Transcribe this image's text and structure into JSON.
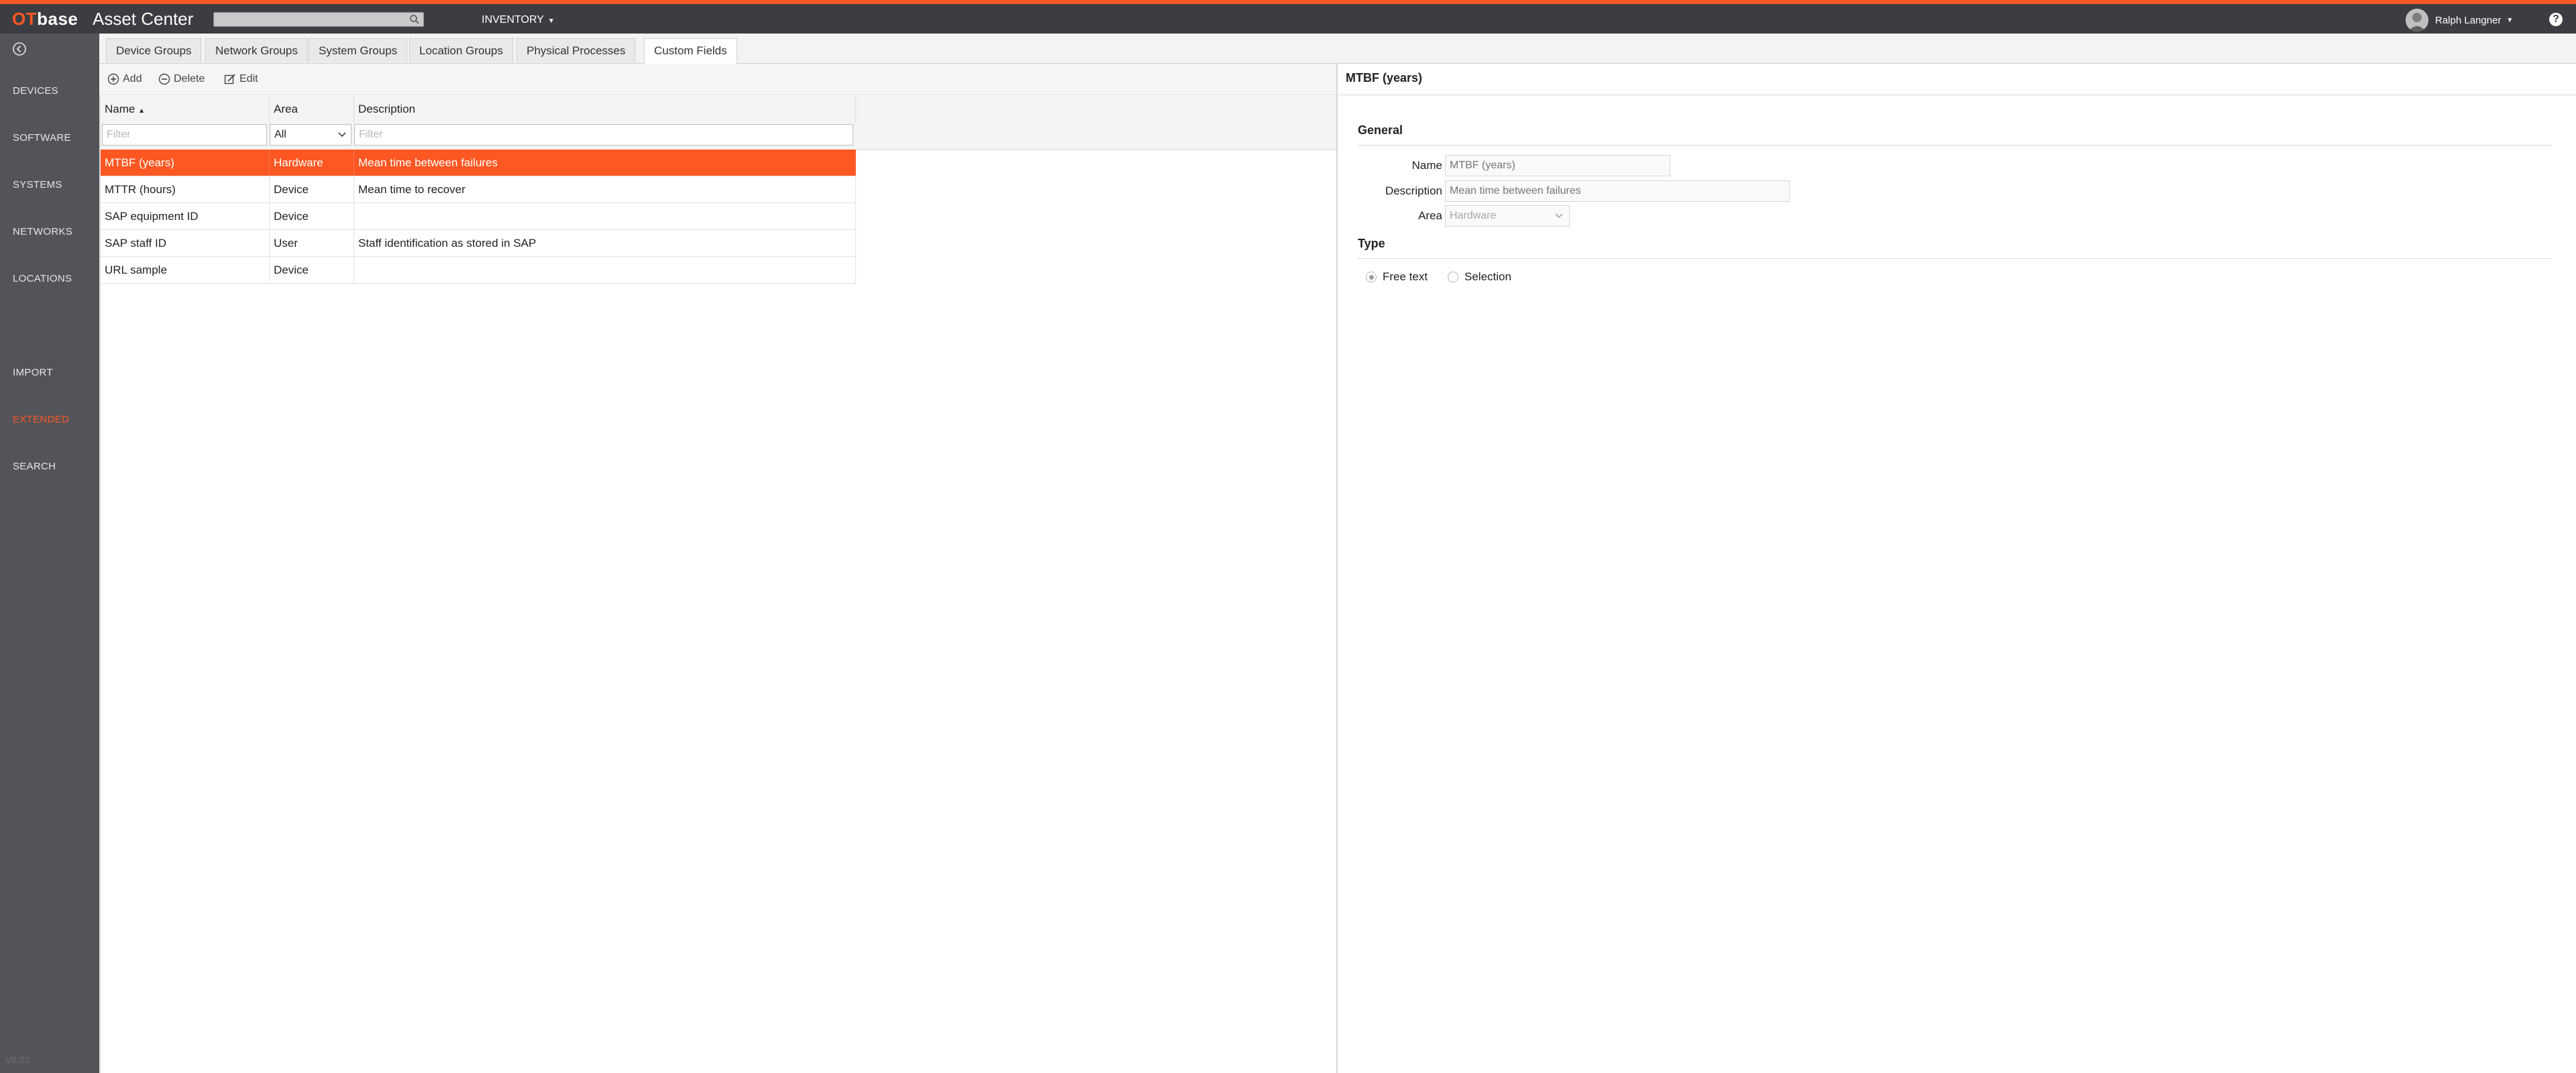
{
  "app": {
    "logo_ot": "OT",
    "logo_base": "base",
    "title": "Asset Center",
    "search_placeholder": "",
    "inventory_label": "INVENTORY",
    "user_name": "Ralph Langner",
    "help_label": "?"
  },
  "sidebar": {
    "items": [
      {
        "label": "DEVICES"
      },
      {
        "label": "SOFTWARE"
      },
      {
        "label": "SYSTEMS"
      },
      {
        "label": "NETWORKS"
      },
      {
        "label": "LOCATIONS"
      },
      {
        "label": "IMPORT"
      },
      {
        "label": "EXTENDED",
        "active": true
      },
      {
        "label": "SEARCH"
      }
    ],
    "version": "V6.03"
  },
  "tabs": [
    {
      "label": "Device Groups"
    },
    {
      "label": "Network Groups"
    },
    {
      "label": "System Groups"
    },
    {
      "label": "Location Groups"
    },
    {
      "label": "Physical Processes"
    },
    {
      "label": "Custom Fields",
      "active": true
    }
  ],
  "toolbar": {
    "add_label": "Add",
    "delete_label": "Delete",
    "edit_label": "Edit"
  },
  "grid": {
    "columns": [
      {
        "label": "Name",
        "sort": "asc"
      },
      {
        "label": "Area"
      },
      {
        "label": "Description"
      }
    ],
    "filters": {
      "name_placeholder": "Filter",
      "area_value": "All",
      "description_placeholder": "Filter"
    },
    "rows": [
      {
        "name": "MTBF (years)",
        "area": "Hardware",
        "description": "Mean time between failures",
        "selected": true
      },
      {
        "name": "MTTR (hours)",
        "area": "Device",
        "description": "Mean time to recover"
      },
      {
        "name": "SAP equipment ID",
        "area": "Device",
        "description": ""
      },
      {
        "name": "SAP staff ID",
        "area": "User",
        "description": "Staff identification as stored in SAP"
      },
      {
        "name": "URL sample",
        "area": "Device",
        "description": ""
      }
    ]
  },
  "detail": {
    "title": "MTBF (years)",
    "general_title": "General",
    "name_label": "Name",
    "name_value": "MTBF (years)",
    "description_label": "Description",
    "description_value": "Mean time between failures",
    "area_label": "Area",
    "area_value": "Hardware",
    "type_title": "Type",
    "type_options": [
      {
        "label": "Free text",
        "checked": true
      },
      {
        "label": "Selection",
        "checked": false
      }
    ]
  },
  "colors": {
    "accent": "#ff5722",
    "topbar": "#3b3d42",
    "sidebar": "#535459"
  }
}
